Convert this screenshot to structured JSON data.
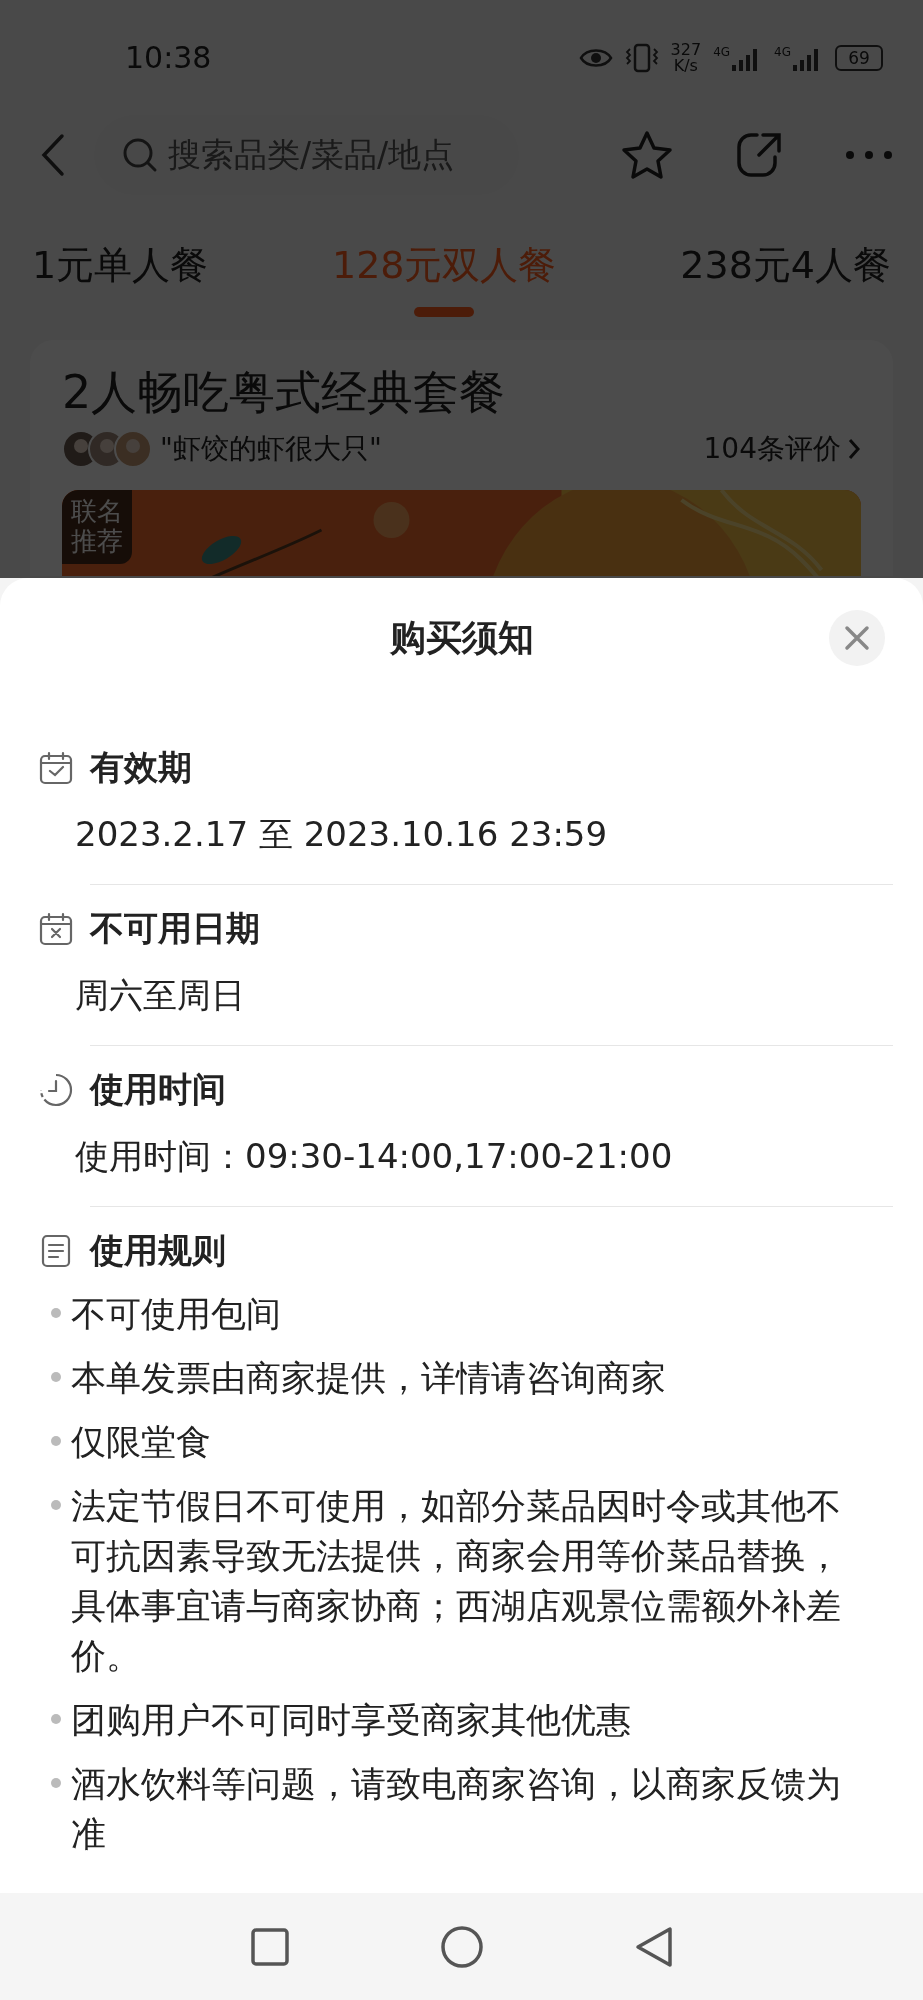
{
  "status_bar": {
    "time": "10:38",
    "speed": [
      "327",
      "K/s"
    ],
    "networks": [
      "4G",
      "4G"
    ],
    "battery": "69"
  },
  "header": {
    "search": {
      "placeholder": "搜索品类/菜品/地点"
    }
  },
  "tabs": [
    {
      "label": "1元单人餐",
      "selected": false
    },
    {
      "label": "128元双人餐",
      "selected": true
    },
    {
      "label": "238元4人餐",
      "selected": false
    }
  ],
  "deal": {
    "title": "2人畅吃粤式经典套餐",
    "quote": "\"虾饺的虾很大只\"",
    "reviews": "104条评价",
    "banner": {
      "kind": "picture",
      "badge": "联名推荐"
    }
  },
  "sheet": {
    "title": "购买须知",
    "sections": [
      {
        "kind": "validity",
        "title": "有效期",
        "lines": [
          "2023.2.17 至 2023.10.16 23:59"
        ]
      },
      {
        "kind": "blackout",
        "title": "不可用日期",
        "lines": [
          "周六至周日"
        ]
      },
      {
        "kind": "hours",
        "title": "使用时间",
        "lines": [
          "使用时间：09:30-14:00,17:00-21:00"
        ]
      },
      {
        "kind": "rules",
        "title": "使用规则",
        "lines": [
          "不可使用包间",
          "本单发票由商家提供，详情请咨询商家",
          "仅限堂食",
          "法定节假日不可使用，如部分菜品因时令或其他不可抗因素导致无法提供，商家会用等价菜品替换，具体事宜请与商家协商；西湖店观景位需额外补差价。",
          "团购用户不可同时享受商家其他优惠",
          "酒水饮料等问题，请致电商家咨询，以商家反馈为准"
        ]
      }
    ]
  }
}
